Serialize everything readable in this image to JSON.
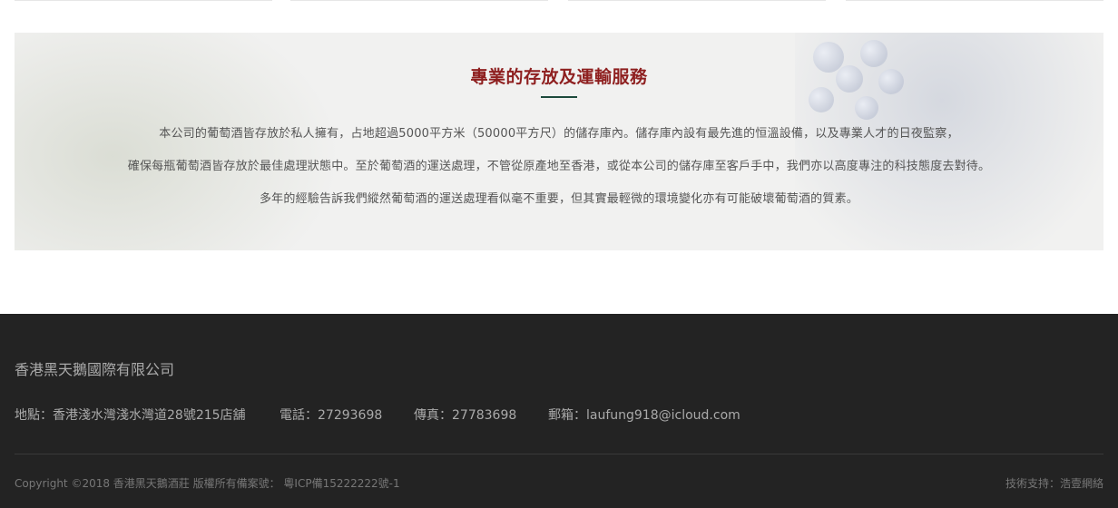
{
  "service": {
    "title": "專業的存放及運輸服務",
    "paragraph_lines": [
      "本公司的葡萄酒皆存放於私人擁有，占地超過5000平方米（50000平方尺）的儲存庫內。儲存庫內設有最先進的恒溫設備，以及專業人才的日夜監察，",
      "確保每瓶葡萄酒皆存放於最佳處理狀態中。至於葡萄酒的運送處理，不管從原產地至香港，或從本公司的儲存庫至客戶手中，我們亦以高度專注的科技態度去對待。",
      "多年的經驗告訴我們縱然葡萄酒的運送處理看似毫不重要，但其實最輕微的環境變化亦有可能破壞葡萄酒的質素。"
    ]
  },
  "footer": {
    "company_name": "香港黑天鵝國際有限公司",
    "address": "地點：香港淺水灣淺水灣道28號215店舖",
    "phone": "電話：27293698",
    "fax": "傳真：27783698",
    "email": "郵箱：laufung918@icloud.com",
    "copyright": "Copyright ©2018 香港黑天鵝酒莊 版權所有備案號：  粵ICP備15222222號-1",
    "tech_support": "技術支持：浩壹網絡"
  },
  "colors": {
    "title_red": "#8e1f1f",
    "title_rule_green": "#1d4a3c",
    "footer_bg": "#232323"
  }
}
